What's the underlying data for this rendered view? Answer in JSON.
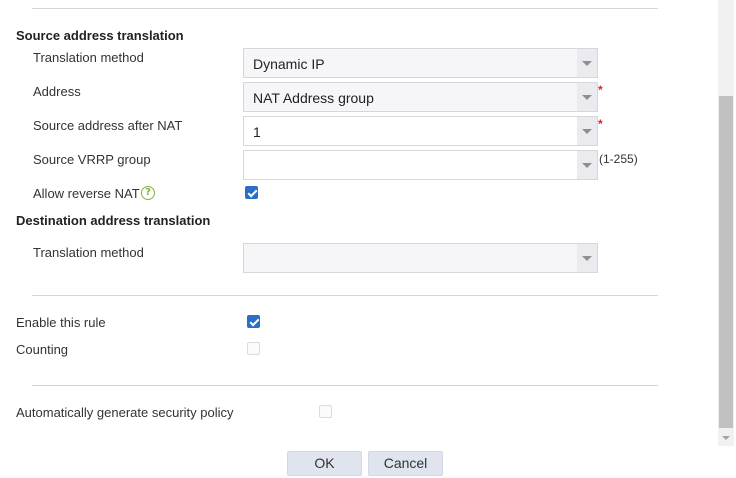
{
  "source_section": {
    "title": "Source address translation",
    "translation_method": {
      "label": "Translation method",
      "value": "Dynamic IP"
    },
    "address": {
      "label": "Address",
      "value": "NAT Address group",
      "required_mark": "*"
    },
    "source_after_nat": {
      "label": "Source address after NAT",
      "value": "1",
      "required_mark": "*"
    },
    "vrrp_group": {
      "label": "Source VRRP group",
      "value": "",
      "hint": "(1-255)"
    },
    "allow_reverse_nat": {
      "label": "Allow reverse NAT",
      "help_icon": "?",
      "checked": true
    }
  },
  "destination_section": {
    "title": "Destination address translation",
    "translation_method": {
      "label": "Translation method",
      "value": ""
    }
  },
  "rule": {
    "enable_label": "Enable this rule",
    "enable_checked": true,
    "counting_label": "Counting",
    "counting_checked": false
  },
  "policy": {
    "auto_generate_label": "Automatically generate security policy",
    "auto_generate_checked": false
  },
  "buttons": {
    "ok": "OK",
    "cancel": "Cancel"
  }
}
